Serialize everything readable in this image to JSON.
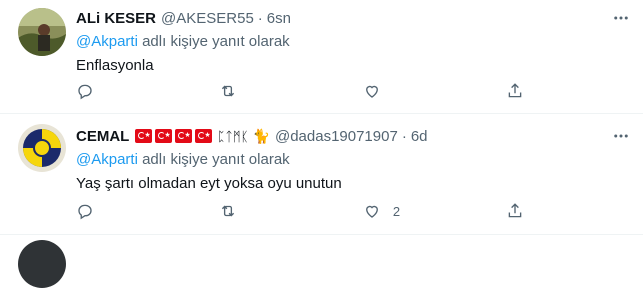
{
  "tweets": [
    {
      "name": "ALi KESER",
      "handle": "@AKESER55",
      "time": "6sn",
      "reply_prefix": "",
      "mention": "@Akparti",
      "reply_suffix": " adlı kişiye yanıt olarak",
      "text": "Enflasyonla",
      "like_count": ""
    },
    {
      "name": "CEMAL",
      "name_extra": "ᛈᛏᛗᛕ",
      "emoji": "🐈",
      "handle": "@dadas19071907",
      "time": "6d",
      "mention": "@Akparti",
      "reply_suffix": " adlı kişiye yanıt olarak",
      "text": "Yaş şartı olmadan eyt yoksa oyu unutun",
      "like_count": "2"
    }
  ],
  "separator": "·",
  "icons": [
    "reply-icon",
    "retweet-icon",
    "like-icon",
    "share-icon",
    "more-icon"
  ],
  "colors": {
    "accent": "#1d9bf0",
    "muted": "#536471",
    "text": "#0f1419",
    "flag": "#e30a17"
  }
}
